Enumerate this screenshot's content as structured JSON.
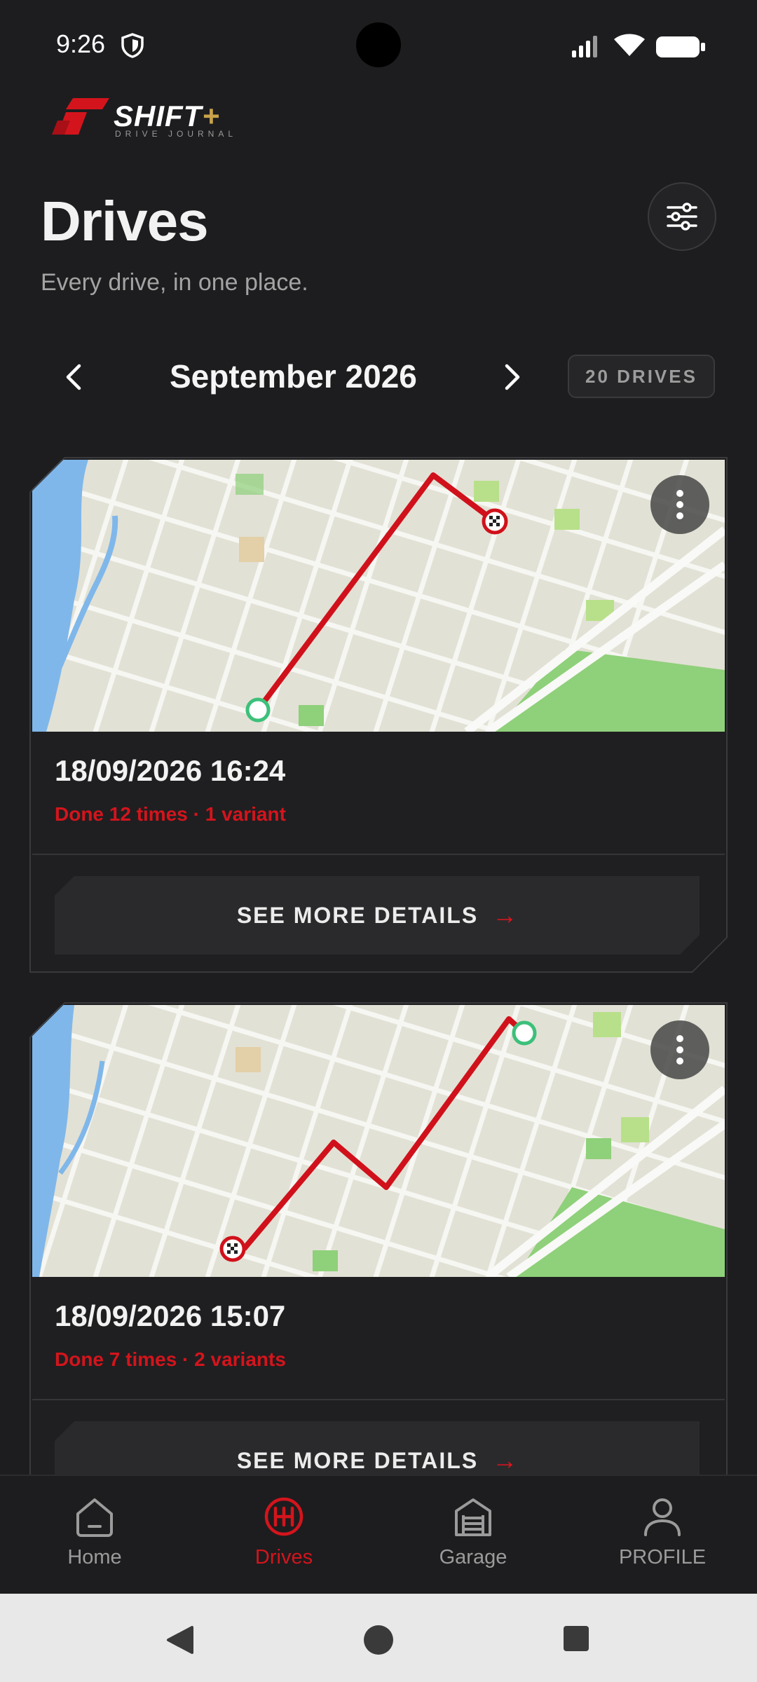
{
  "status_bar": {
    "time": "9:26"
  },
  "logo": {
    "brand": "SHIFT",
    "plus": "+",
    "tagline": "DRIVE JOURNAL"
  },
  "header": {
    "title": "Drives",
    "subtitle": "Every drive, in one place."
  },
  "month_nav": {
    "month": "September 2026",
    "count": "20 DRIVES"
  },
  "drives": [
    {
      "date": "18/09/2026 16:24",
      "meta": "Done 12 times · 1 variant",
      "details_label": "SEE MORE DETAILS",
      "arrow": "→"
    },
    {
      "date": "18/09/2026 15:07",
      "meta": "Done 7 times · 2 variants",
      "details_label": "SEE MORE DETAILS",
      "arrow": "→"
    }
  ],
  "bottom_nav": [
    {
      "label": "Home",
      "icon": "home-icon",
      "active": false
    },
    {
      "label": "Drives",
      "icon": "steering-icon",
      "active": true
    },
    {
      "label": "Garage",
      "icon": "garage-icon",
      "active": false
    },
    {
      "label": "PROFILE",
      "icon": "profile-icon",
      "active": false
    }
  ],
  "colors": {
    "accent": "#d4141c",
    "background": "#1d1d1f",
    "gold": "#c9a24a",
    "route": "#d0111b",
    "start": "#3cc07a"
  }
}
